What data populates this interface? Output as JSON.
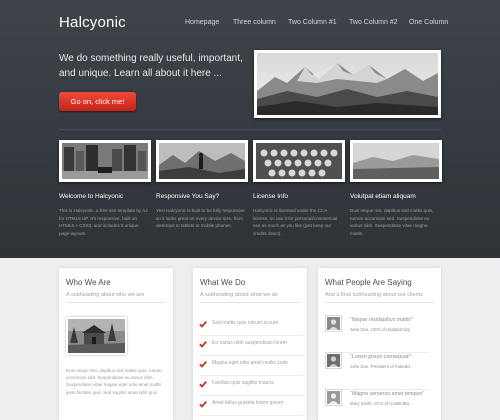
{
  "site": {
    "logo": "Halcyonic"
  },
  "nav": {
    "items": [
      {
        "label": "Homepage"
      },
      {
        "label": "Three column"
      },
      {
        "label": "Two Column #1"
      },
      {
        "label": "Two Column #2"
      },
      {
        "label": "One Column"
      }
    ]
  },
  "hero": {
    "text": "We do something really useful, important, and unique. Learn all about it here ...",
    "button_label": "Go on, click me!"
  },
  "features": [
    {
      "title": "Welcome to Halcyonic",
      "text": "This is Halcyonic, a free site template by AJ for HTML5 UP. It's responsive, built on HTML5 + CSS3, and includes 5 unique page layouts."
    },
    {
      "title": "Responsive You Say?",
      "text": "Yes! Halcyonic is built to be fully responsive so it looks great on every device size, from desktops to tablets to mobile phones."
    },
    {
      "title": "License Info",
      "text": "Halcyonic is licensed under the CCA license, so use it for personal/commercial use as much as you like (just keep our credits intact)."
    },
    {
      "title": "Volutpat etiam aliquam",
      "text": "Duis neque nisi, dapibus sed mattis quis, rutrum accumsan sed. Suspendisse eu varius nibh. Suspendisse vitae magna mattis."
    }
  ],
  "who": {
    "title": "Who We Are",
    "subtitle": "A subheading about who we are",
    "text": "Duis neque nisi, dapibus sed mattis quis, rutrum accumsan sed. Suspendisse eu varius nibh. Suspendisse vitae magna eget odio amet mollis justo facilisis quis. Sed sagittis amet nibh quis."
  },
  "what": {
    "title": "What We Do",
    "subtitle": "A subheading about what we do",
    "items": [
      {
        "label": "Sed mattis quis rutrum accum"
      },
      {
        "label": "Eu varius nibh suspendisse lorem"
      },
      {
        "label": "Magna eget odio amet mollis justo"
      },
      {
        "label": "Facilisis quis sagittis mauris"
      },
      {
        "label": "Amet tellus gravida lorem ipsum"
      }
    ]
  },
  "testimonials": {
    "title": "What People Are Saying",
    "subtitle": "And a final subheading about our clients",
    "items": [
      {
        "quote": "“Neque nisidapibus mattis”",
        "author": "Jane Doe, CEO of UntitledCorp"
      },
      {
        "quote": "“Lorem ipsum consequat!”",
        "author": "John Doe, President of FakeBiz"
      },
      {
        "quote": "“Magna veroeros amet tempus”",
        "author": "Mary Smith, CFO of UntitledBiz"
      }
    ]
  },
  "colors": {
    "header_bg": "#3a3f45",
    "accent": "#d93a2b",
    "body_bg": "#eceef0"
  }
}
